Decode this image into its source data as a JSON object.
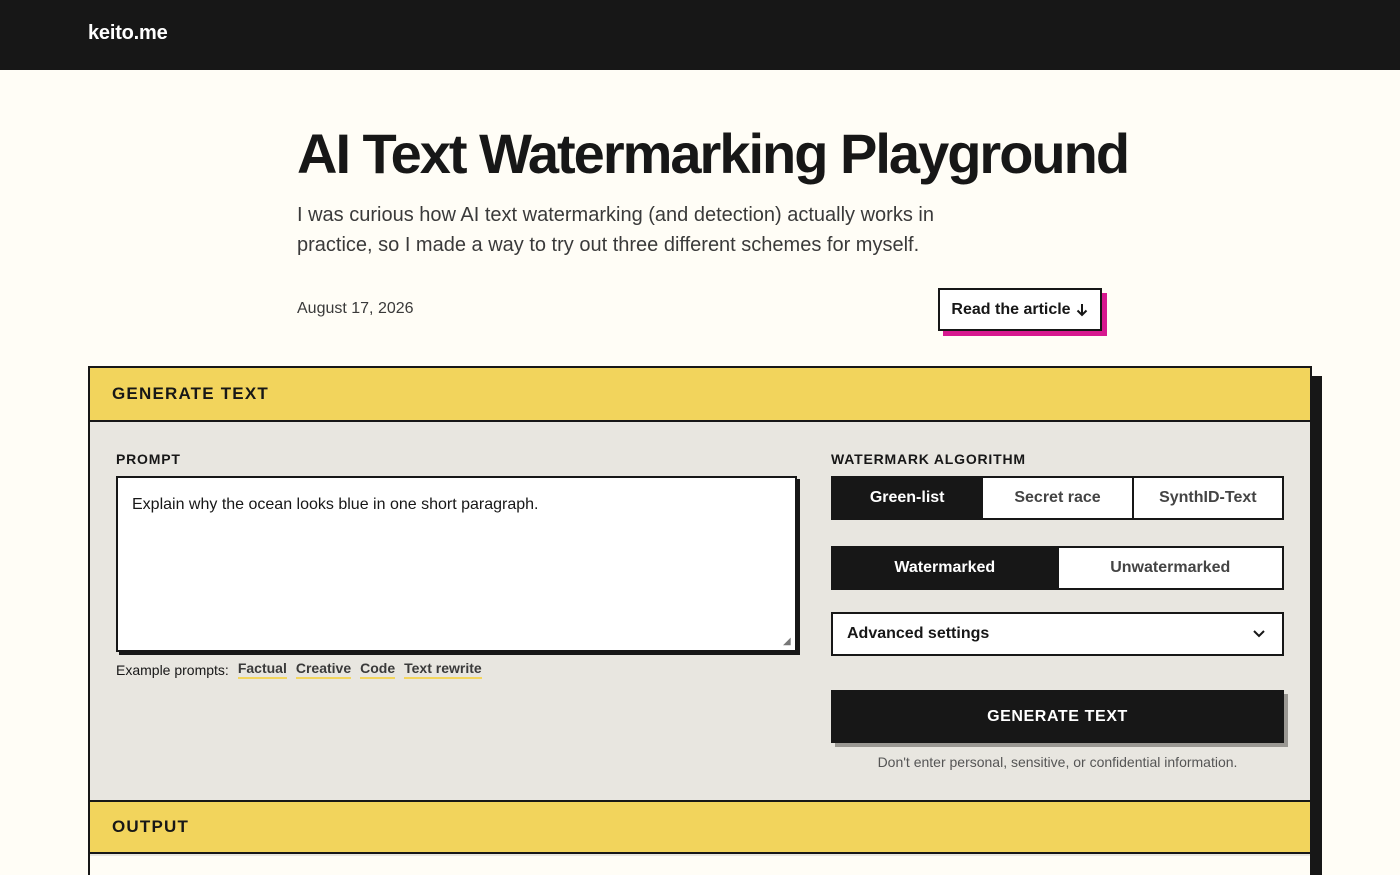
{
  "header": {
    "brand": "keito.me"
  },
  "hero": {
    "title": "AI Text Watermarking Playground",
    "intro": "I was curious how AI text watermarking (and detection) actually works in practice, so I made a way to try out three different schemes for myself.",
    "date": "August 17, 2026",
    "read_button": "Read the article",
    "read_icon": "arrow-down-icon"
  },
  "generate": {
    "section_title": "GENERATE TEXT",
    "prompt_label": "PROMPT",
    "prompt_value": "Explain why the ocean looks blue in one short paragraph.",
    "examples_label": "Example prompts:",
    "examples": [
      "Factual",
      "Creative",
      "Code",
      "Text rewrite"
    ],
    "algorithm_label": "WATERMARK ALGORITHM",
    "algorithms": [
      "Green-list",
      "Secret race",
      "SynthID-Text"
    ],
    "selected_algorithm": "Green-list",
    "modes": [
      "Watermarked",
      "Unwatermarked"
    ],
    "selected_mode": "Watermarked",
    "advanced_label": "Advanced settings",
    "advanced_icon": "chevron-down-icon",
    "generate_button": "GENERATE TEXT",
    "disclaimer": "Don't enter personal, sensitive, or confidential information."
  },
  "output": {
    "section_title": "OUTPUT"
  },
  "colors": {
    "accent_yellow": "#f2d45c",
    "accent_pink": "#d6188f",
    "dark": "#171717",
    "page_bg": "#fffdf6"
  }
}
